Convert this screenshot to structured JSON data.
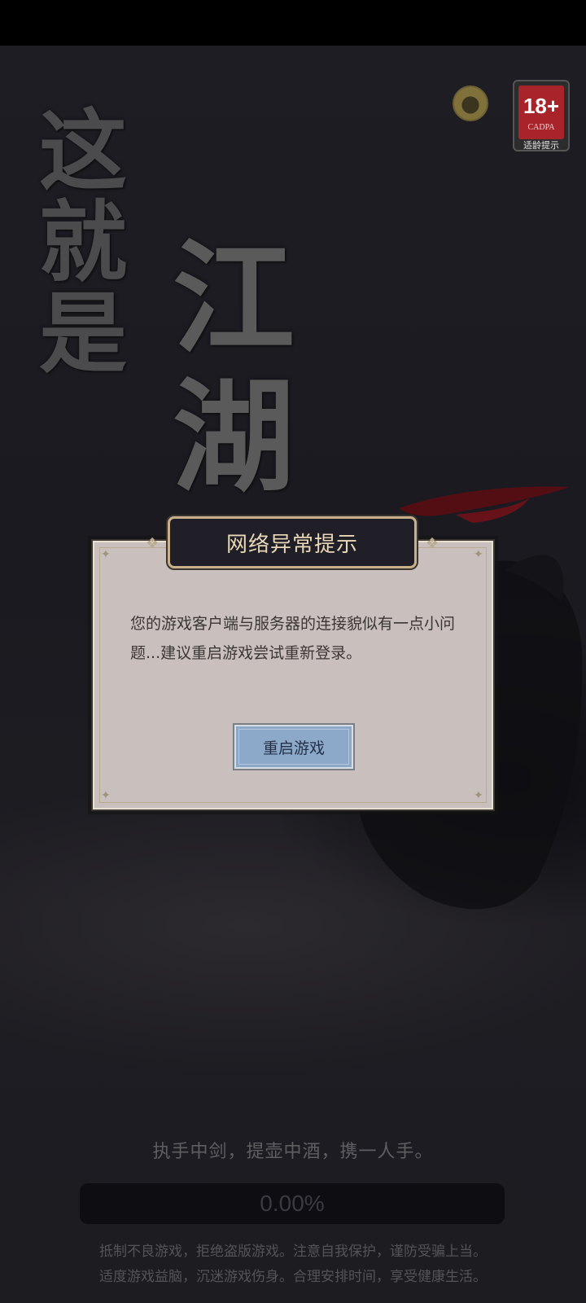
{
  "title": {
    "line1": [
      "这",
      "就",
      "是"
    ],
    "line2": [
      "江",
      "湖"
    ]
  },
  "age_rating": {
    "age": "18+",
    "org": "CADPA",
    "caption": "适龄提示",
    "color": "#a8232a"
  },
  "avatar": {
    "icon": "user-avatar-icon"
  },
  "dialog": {
    "title": "网络异常提示",
    "message": "您的游戏客户端与服务器的连接貌似有一点小问题...建议重启游戏尝试重新登录。",
    "button_label": "重启游戏"
  },
  "tagline": "执手中剑，提壶中酒，携一人手。",
  "progress": {
    "label": "0.00%",
    "value": 0.0
  },
  "health_notice": {
    "line1": "抵制不良游戏，拒绝盗版游戏。注意自我保护，谨防受骗上当。",
    "line2": "适度游戏益脑，沉迷游戏伤身。合理安排时间，享受健康生活。"
  }
}
